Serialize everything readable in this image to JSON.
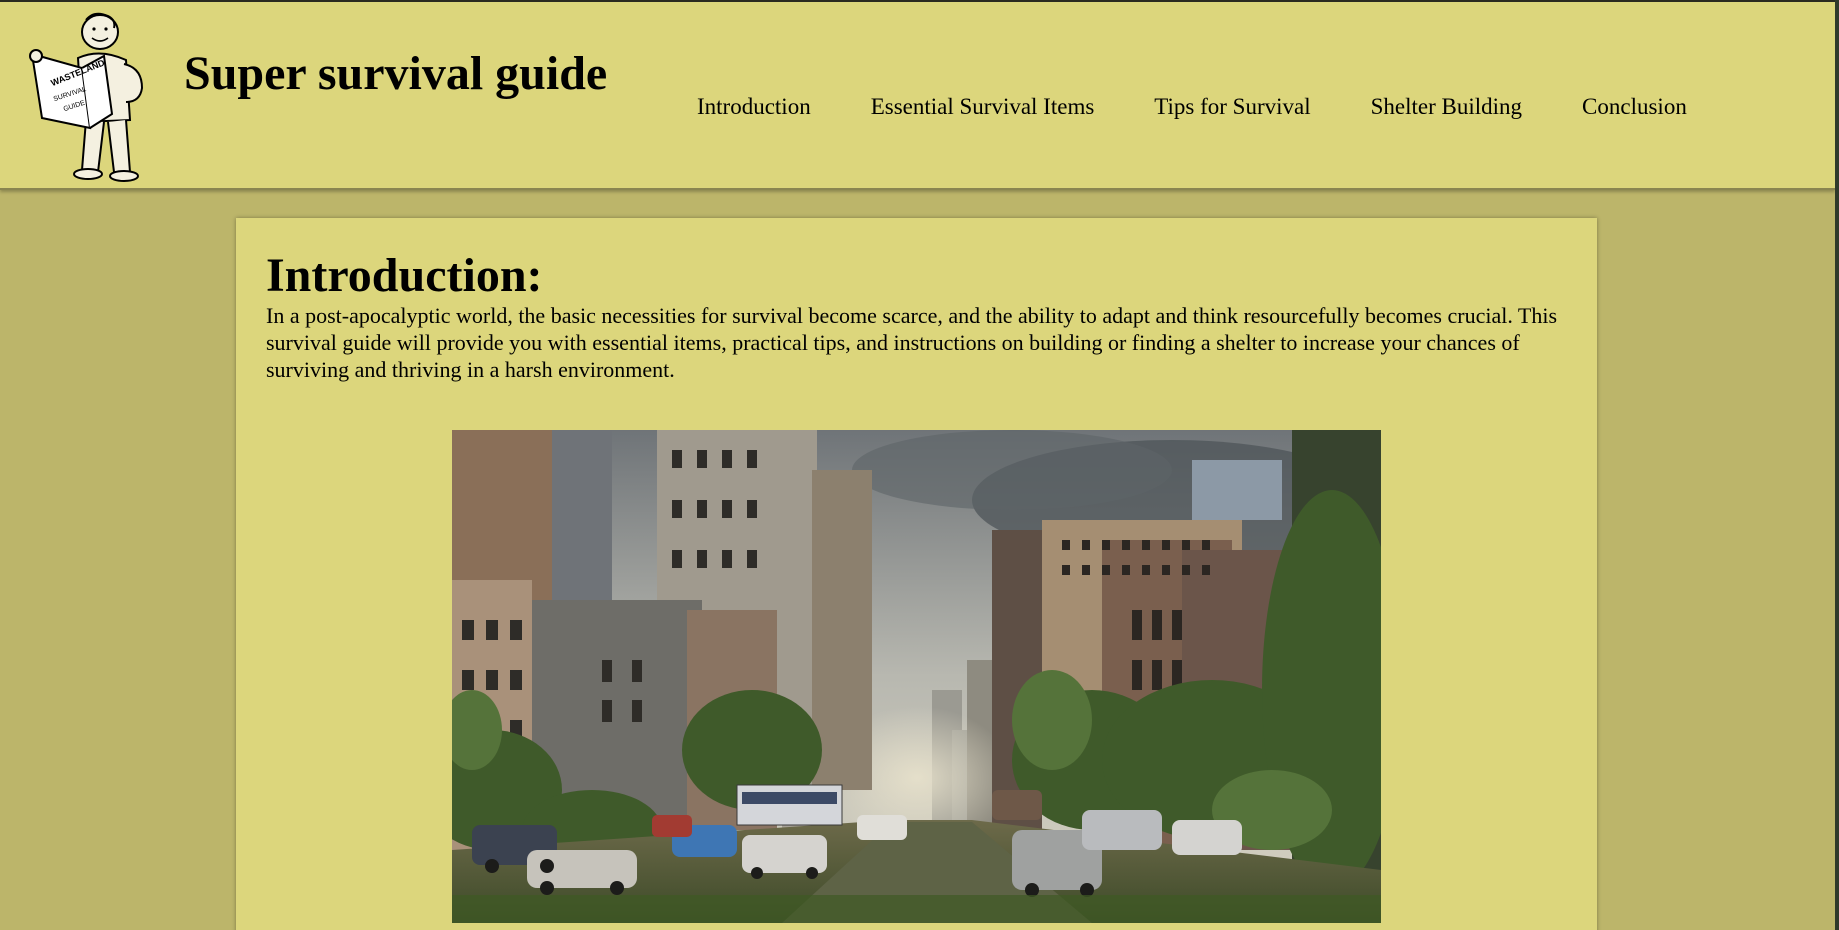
{
  "header": {
    "site_title": "Super survival guide",
    "logo": {
      "icon": "vault-boy-reading-guide-icon",
      "book_text": [
        "WASTELAND",
        "SURVIVAL",
        "GUIDE"
      ]
    }
  },
  "nav": {
    "items": [
      {
        "label": "Introduction"
      },
      {
        "label": "Essential Survival Items"
      },
      {
        "label": "Tips for Survival"
      },
      {
        "label": "Shelter Building"
      },
      {
        "label": "Conclusion"
      }
    ]
  },
  "main": {
    "section_title": "Introduction:",
    "section_body": "In a post-apocalyptic world, the basic necessities for survival become scarce, and the ability to adapt and think resourcefully becomes crucial. This survival guide will provide you with essential items, practical tips, and instructions on building or finding a shelter to increase your chances of surviving and thriving in a harsh environment.",
    "hero_image": {
      "icon": "abandoned-overgrown-city-street-image"
    }
  },
  "colors": {
    "page_background": "#bcb56a",
    "header_background": "#dcd67c",
    "card_background": "#dcd67c"
  }
}
